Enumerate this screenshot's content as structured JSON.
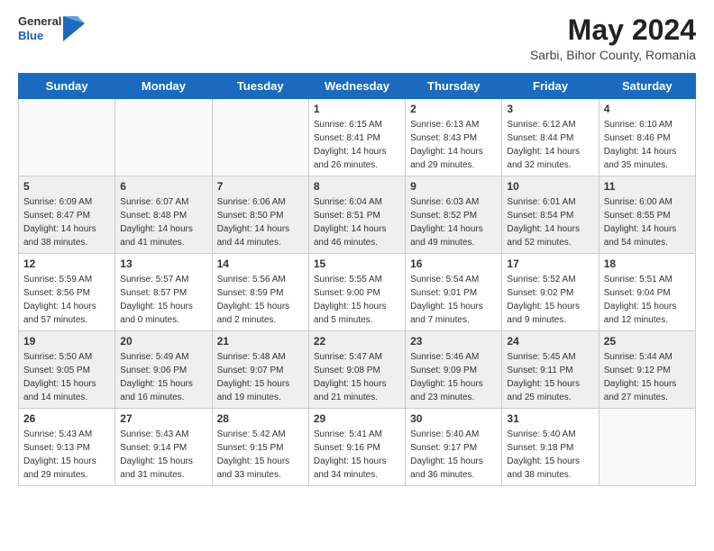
{
  "header": {
    "logo": {
      "general": "General",
      "blue": "Blue"
    },
    "title": "May 2024",
    "subtitle": "Sarbi, Bihor County, Romania"
  },
  "calendar": {
    "days_of_week": [
      "Sunday",
      "Monday",
      "Tuesday",
      "Wednesday",
      "Thursday",
      "Friday",
      "Saturday"
    ],
    "rows": [
      [
        {
          "day": "",
          "info": ""
        },
        {
          "day": "",
          "info": ""
        },
        {
          "day": "",
          "info": ""
        },
        {
          "day": "1",
          "info": "Sunrise: 6:15 AM\nSunset: 8:41 PM\nDaylight: 14 hours\nand 26 minutes."
        },
        {
          "day": "2",
          "info": "Sunrise: 6:13 AM\nSunset: 8:43 PM\nDaylight: 14 hours\nand 29 minutes."
        },
        {
          "day": "3",
          "info": "Sunrise: 6:12 AM\nSunset: 8:44 PM\nDaylight: 14 hours\nand 32 minutes."
        },
        {
          "day": "4",
          "info": "Sunrise: 6:10 AM\nSunset: 8:46 PM\nDaylight: 14 hours\nand 35 minutes."
        }
      ],
      [
        {
          "day": "5",
          "info": "Sunrise: 6:09 AM\nSunset: 8:47 PM\nDaylight: 14 hours\nand 38 minutes."
        },
        {
          "day": "6",
          "info": "Sunrise: 6:07 AM\nSunset: 8:48 PM\nDaylight: 14 hours\nand 41 minutes."
        },
        {
          "day": "7",
          "info": "Sunrise: 6:06 AM\nSunset: 8:50 PM\nDaylight: 14 hours\nand 44 minutes."
        },
        {
          "day": "8",
          "info": "Sunrise: 6:04 AM\nSunset: 8:51 PM\nDaylight: 14 hours\nand 46 minutes."
        },
        {
          "day": "9",
          "info": "Sunrise: 6:03 AM\nSunset: 8:52 PM\nDaylight: 14 hours\nand 49 minutes."
        },
        {
          "day": "10",
          "info": "Sunrise: 6:01 AM\nSunset: 8:54 PM\nDaylight: 14 hours\nand 52 minutes."
        },
        {
          "day": "11",
          "info": "Sunrise: 6:00 AM\nSunset: 8:55 PM\nDaylight: 14 hours\nand 54 minutes."
        }
      ],
      [
        {
          "day": "12",
          "info": "Sunrise: 5:59 AM\nSunset: 8:56 PM\nDaylight: 14 hours\nand 57 minutes."
        },
        {
          "day": "13",
          "info": "Sunrise: 5:57 AM\nSunset: 8:57 PM\nDaylight: 15 hours\nand 0 minutes."
        },
        {
          "day": "14",
          "info": "Sunrise: 5:56 AM\nSunset: 8:59 PM\nDaylight: 15 hours\nand 2 minutes."
        },
        {
          "day": "15",
          "info": "Sunrise: 5:55 AM\nSunset: 9:00 PM\nDaylight: 15 hours\nand 5 minutes."
        },
        {
          "day": "16",
          "info": "Sunrise: 5:54 AM\nSunset: 9:01 PM\nDaylight: 15 hours\nand 7 minutes."
        },
        {
          "day": "17",
          "info": "Sunrise: 5:52 AM\nSunset: 9:02 PM\nDaylight: 15 hours\nand 9 minutes."
        },
        {
          "day": "18",
          "info": "Sunrise: 5:51 AM\nSunset: 9:04 PM\nDaylight: 15 hours\nand 12 minutes."
        }
      ],
      [
        {
          "day": "19",
          "info": "Sunrise: 5:50 AM\nSunset: 9:05 PM\nDaylight: 15 hours\nand 14 minutes."
        },
        {
          "day": "20",
          "info": "Sunrise: 5:49 AM\nSunset: 9:06 PM\nDaylight: 15 hours\nand 16 minutes."
        },
        {
          "day": "21",
          "info": "Sunrise: 5:48 AM\nSunset: 9:07 PM\nDaylight: 15 hours\nand 19 minutes."
        },
        {
          "day": "22",
          "info": "Sunrise: 5:47 AM\nSunset: 9:08 PM\nDaylight: 15 hours\nand 21 minutes."
        },
        {
          "day": "23",
          "info": "Sunrise: 5:46 AM\nSunset: 9:09 PM\nDaylight: 15 hours\nand 23 minutes."
        },
        {
          "day": "24",
          "info": "Sunrise: 5:45 AM\nSunset: 9:11 PM\nDaylight: 15 hours\nand 25 minutes."
        },
        {
          "day": "25",
          "info": "Sunrise: 5:44 AM\nSunset: 9:12 PM\nDaylight: 15 hours\nand 27 minutes."
        }
      ],
      [
        {
          "day": "26",
          "info": "Sunrise: 5:43 AM\nSunset: 9:13 PM\nDaylight: 15 hours\nand 29 minutes."
        },
        {
          "day": "27",
          "info": "Sunrise: 5:43 AM\nSunset: 9:14 PM\nDaylight: 15 hours\nand 31 minutes."
        },
        {
          "day": "28",
          "info": "Sunrise: 5:42 AM\nSunset: 9:15 PM\nDaylight: 15 hours\nand 33 minutes."
        },
        {
          "day": "29",
          "info": "Sunrise: 5:41 AM\nSunset: 9:16 PM\nDaylight: 15 hours\nand 34 minutes."
        },
        {
          "day": "30",
          "info": "Sunrise: 5:40 AM\nSunset: 9:17 PM\nDaylight: 15 hours\nand 36 minutes."
        },
        {
          "day": "31",
          "info": "Sunrise: 5:40 AM\nSunset: 9:18 PM\nDaylight: 15 hours\nand 38 minutes."
        },
        {
          "day": "",
          "info": ""
        }
      ]
    ]
  }
}
